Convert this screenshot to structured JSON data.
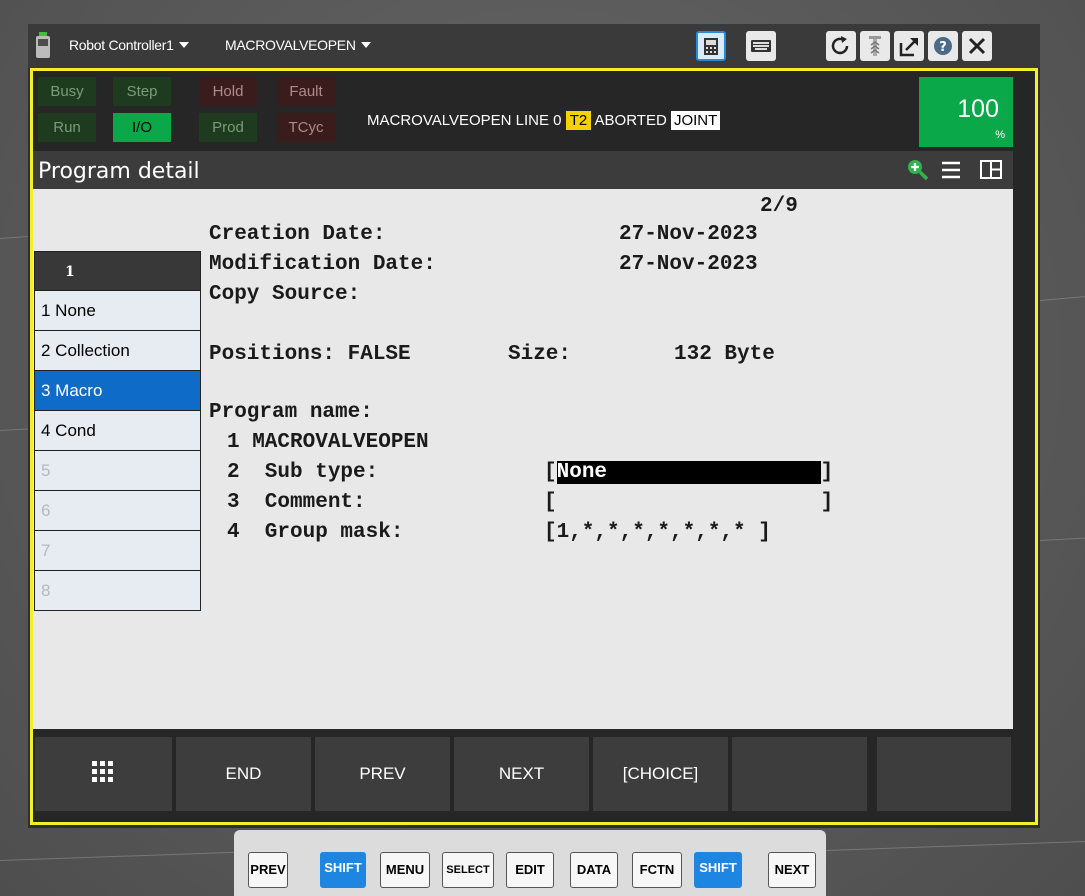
{
  "titlebar": {
    "controller": "Robot Controller1",
    "program": "MACROVALVEOPEN",
    "icons": [
      "tp-view-icon",
      "keyboard-icon",
      "refresh-icon",
      "brake-icon",
      "window-arrow-icon",
      "help-icon",
      "close-icon"
    ]
  },
  "status": {
    "busy": "Busy",
    "step": "Step",
    "hold": "Hold",
    "fault": "Fault",
    "run": "Run",
    "io": "I/O",
    "prod": "Prod",
    "tcyc": "TCyc",
    "line_text": "MACROVALVEOPEN LINE 0",
    "mode": "T2",
    "state": "ABORTED",
    "coord": "JOINT",
    "override": "100",
    "override_unit": "%"
  },
  "colors": {
    "frame": "#f4ee2c",
    "io_active": "#0ba84a",
    "selection": "#0e6cc8",
    "t2_badge": "#f5d100"
  },
  "header": {
    "title": "Program detail"
  },
  "detail": {
    "page": "2/9",
    "creation_label": "Creation Date:",
    "creation_value": "27-Nov-2023",
    "modification_label": "Modification Date:",
    "modification_value": "27-Nov-2023",
    "copy_label": "Copy Source:",
    "positions_label": "Positions: FALSE",
    "size_label": "Size:",
    "size_value": "132 Byte",
    "program_name_label": "Program name:",
    "line1": "1 MACROVALVEOPEN",
    "line2_label": "2  Sub type:",
    "line2_open": "[",
    "line2_value": "None",
    "line2_close": "]",
    "line3_label": "3  Comment:",
    "line3_open": "[",
    "line3_close": "]",
    "line4_label": "4  Group mask:",
    "line4_value": "[1,*,*,*,*,*,*,* ]"
  },
  "sidelist": {
    "header": "1",
    "items": [
      "1 None",
      "2 Collection",
      "3 Macro",
      "4 Cond",
      "5",
      "6",
      "7",
      "8"
    ],
    "selected_index": 2
  },
  "fkeys": {
    "f1": "END",
    "f2": "PREV",
    "f3": "NEXT",
    "f4": "[CHOICE]"
  },
  "hardkeys": [
    "PREV",
    "SHIFT",
    "MENU",
    "SELECT",
    "EDIT",
    "DATA",
    "FCTN",
    "SHIFT",
    "NEXT"
  ]
}
